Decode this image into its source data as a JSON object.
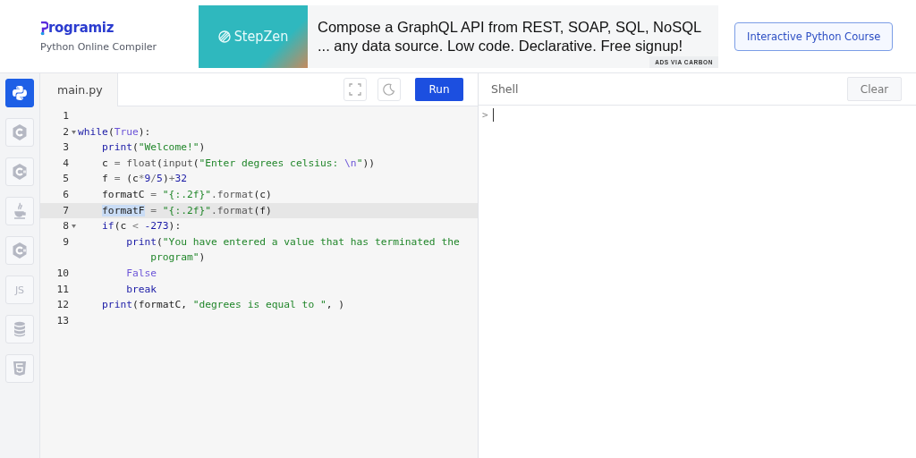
{
  "header": {
    "brand": "rogramiz",
    "subtitle": "Python Online Compiler",
    "ad": {
      "logo_text": "StepZen",
      "lines": [
        "Compose a GraphQL API from REST, SOAP, SQL, NoSQL",
        "... any data source. Low code. Declarative. Free signup!"
      ],
      "credit": "ADS VIA CARBON"
    },
    "course_button": "Interactive Python Course"
  },
  "sidebar": {
    "items": [
      {
        "kind": "python",
        "selected": true
      },
      {
        "kind": "c",
        "selected": false
      },
      {
        "kind": "cpp",
        "selected": false
      },
      {
        "kind": "java",
        "selected": false
      },
      {
        "kind": "csharp",
        "selected": false
      },
      {
        "kind": "js",
        "label": "JS",
        "selected": false
      },
      {
        "kind": "sql",
        "selected": false
      },
      {
        "kind": "html",
        "selected": false
      }
    ]
  },
  "editor": {
    "tab": "main.py",
    "run_button": "Run",
    "lines": [
      {
        "number": "1",
        "active": false
      },
      {
        "number": "2",
        "active": false,
        "tokens": [
          {
            "kind": "keyword",
            "text": "while"
          },
          {
            "kind": "plain",
            "text": "("
          },
          {
            "kind": "constant",
            "text": "True"
          },
          {
            "kind": "plain",
            "text": "):"
          }
        ],
        "children": [
          {
            "number": "3",
            "active": false,
            "tokens": [
              {
                "kind": "keyword",
                "text": "print"
              },
              {
                "kind": "plain",
                "text": "("
              },
              {
                "kind": "string",
                "text": "\"Welcome!\""
              },
              {
                "kind": "plain",
                "text": ")"
              }
            ]
          },
          {
            "number": "4",
            "active": false,
            "tokens": [
              {
                "kind": "plain",
                "text": "c"
              },
              {
                "kind": "operator",
                "text": " = "
              },
              {
                "kind": "builtin",
                "text": "float"
              },
              {
                "kind": "plain",
                "text": "("
              },
              {
                "kind": "builtin",
                "text": "input"
              },
              {
                "kind": "plain",
                "text": "("
              },
              {
                "kind": "string",
                "text": "\"Enter degrees celsius: "
              },
              {
                "kind": "escape",
                "text": "\\n"
              },
              {
                "kind": "string",
                "text": "\""
              },
              {
                "kind": "plain",
                "text": "))"
              }
            ]
          },
          {
            "number": "5",
            "active": false,
            "tokens": [
              {
                "kind": "plain",
                "text": "f"
              },
              {
                "kind": "operator",
                "text": " = "
              },
              {
                "kind": "plain",
                "text": "(c"
              },
              {
                "kind": "operator",
                "text": "*"
              },
              {
                "kind": "number",
                "text": "9"
              },
              {
                "kind": "operator",
                "text": "/"
              },
              {
                "kind": "number",
                "text": "5"
              },
              {
                "kind": "plain",
                "text": ")"
              },
              {
                "kind": "operator",
                "text": "+"
              },
              {
                "kind": "number",
                "text": "32"
              }
            ]
          },
          {
            "number": "6",
            "active": false,
            "tokens": [
              {
                "kind": "plain",
                "text": "formatC"
              },
              {
                "kind": "operator",
                "text": " = "
              },
              {
                "kind": "string",
                "text": "\"{:.2f}\""
              },
              {
                "kind": "method",
                "text": ".format"
              },
              {
                "kind": "plain",
                "text": "(c)"
              }
            ]
          },
          {
            "number": "7",
            "active": true,
            "tokens": [
              {
                "kind": "plain",
                "text": "formatF",
                "selected": true
              },
              {
                "kind": "operator",
                "text": " = "
              },
              {
                "kind": "string",
                "text": "\"{:.2f}\""
              },
              {
                "kind": "method",
                "text": ".format"
              },
              {
                "kind": "plain",
                "text": "(f)"
              }
            ]
          },
          {
            "number": "8",
            "active": false,
            "tokens": [
              {
                "kind": "keyword",
                "text": "if"
              },
              {
                "kind": "plain",
                "text": "(c"
              },
              {
                "kind": "operator",
                "text": " < "
              },
              {
                "kind": "number",
                "text": "-273"
              },
              {
                "kind": "plain",
                "text": "):"
              }
            ],
            "children": [
              {
                "number": "9",
                "active": false,
                "tokens": [
                  {
                    "kind": "keyword",
                    "text": "print"
                  },
                  {
                    "kind": "plain",
                    "text": "("
                  },
                  {
                    "kind": "string",
                    "text": "\"You have entered a value that has terminated the program\""
                  },
                  {
                    "kind": "plain",
                    "text": ")"
                  }
                ]
              },
              {
                "number": "10",
                "active": false,
                "tokens": [
                  {
                    "kind": "constant",
                    "text": "False"
                  }
                ]
              },
              {
                "number": "11",
                "active": false,
                "tokens": [
                  {
                    "kind": "keyword",
                    "text": "break"
                  }
                ]
              }
            ]
          },
          {
            "number": "12",
            "active": false,
            "tokens": [
              {
                "kind": "keyword",
                "text": "print"
              },
              {
                "kind": "plain",
                "text": "(formatC, "
              },
              {
                "kind": "string",
                "text": "\"degrees is equal to \""
              },
              {
                "kind": "plain",
                "text": ", )"
              }
            ]
          }
        ]
      },
      {
        "number": "13",
        "active": false
      }
    ]
  },
  "shell": {
    "title": "Shell",
    "clear_button": "Clear",
    "prompt": ">"
  }
}
